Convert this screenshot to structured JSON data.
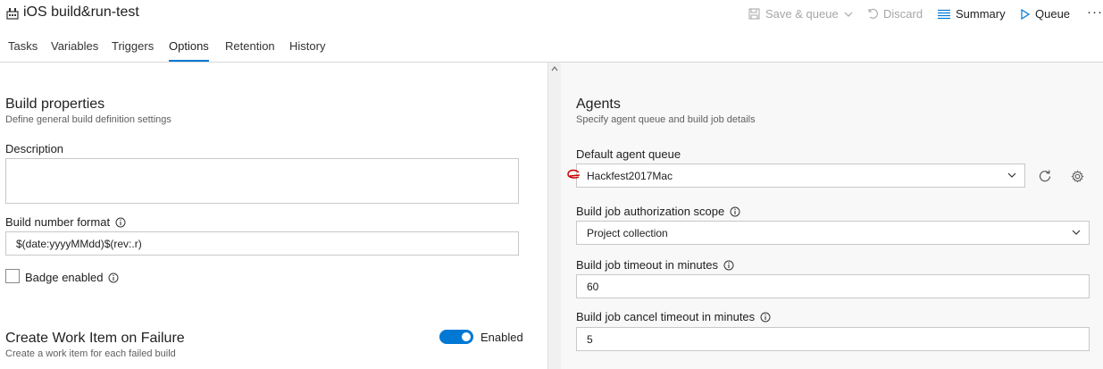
{
  "header": {
    "title": "iOS build&run-test",
    "save_queue_label": "Save & queue",
    "discard_label": "Discard",
    "summary_label": "Summary",
    "queue_label": "Queue",
    "more_label": "···"
  },
  "tabs": [
    {
      "label": "Tasks"
    },
    {
      "label": "Variables"
    },
    {
      "label": "Triggers"
    },
    {
      "label": "Options"
    },
    {
      "label": "Retention"
    },
    {
      "label": "History"
    }
  ],
  "build_properties": {
    "title": "Build properties",
    "subtitle": "Define general build definition settings",
    "description_label": "Description",
    "description_value": "",
    "build_number_format_label": "Build number format",
    "build_number_format_value": "$(date:yyyyMMdd)$(rev:.r)",
    "badge_enabled_label": "Badge enabled"
  },
  "work_item": {
    "title": "Create Work Item on Failure",
    "subtitle": "Create a work item for each failed build",
    "toggle_label": "Enabled"
  },
  "agents": {
    "title": "Agents",
    "subtitle": "Specify agent queue and build job details",
    "default_queue_label": "Default agent queue",
    "default_queue_value": "Hackfest2017Mac",
    "auth_scope_label": "Build job authorization scope",
    "auth_scope_value": "Project collection",
    "timeout_label": "Build job timeout in minutes",
    "timeout_value": "60",
    "cancel_timeout_label": "Build job cancel timeout in minutes",
    "cancel_timeout_value": "5"
  },
  "colors": {
    "accent": "#0078d4",
    "disabled_text": "#a6a6a6",
    "annotation_red": "#cc0000"
  }
}
